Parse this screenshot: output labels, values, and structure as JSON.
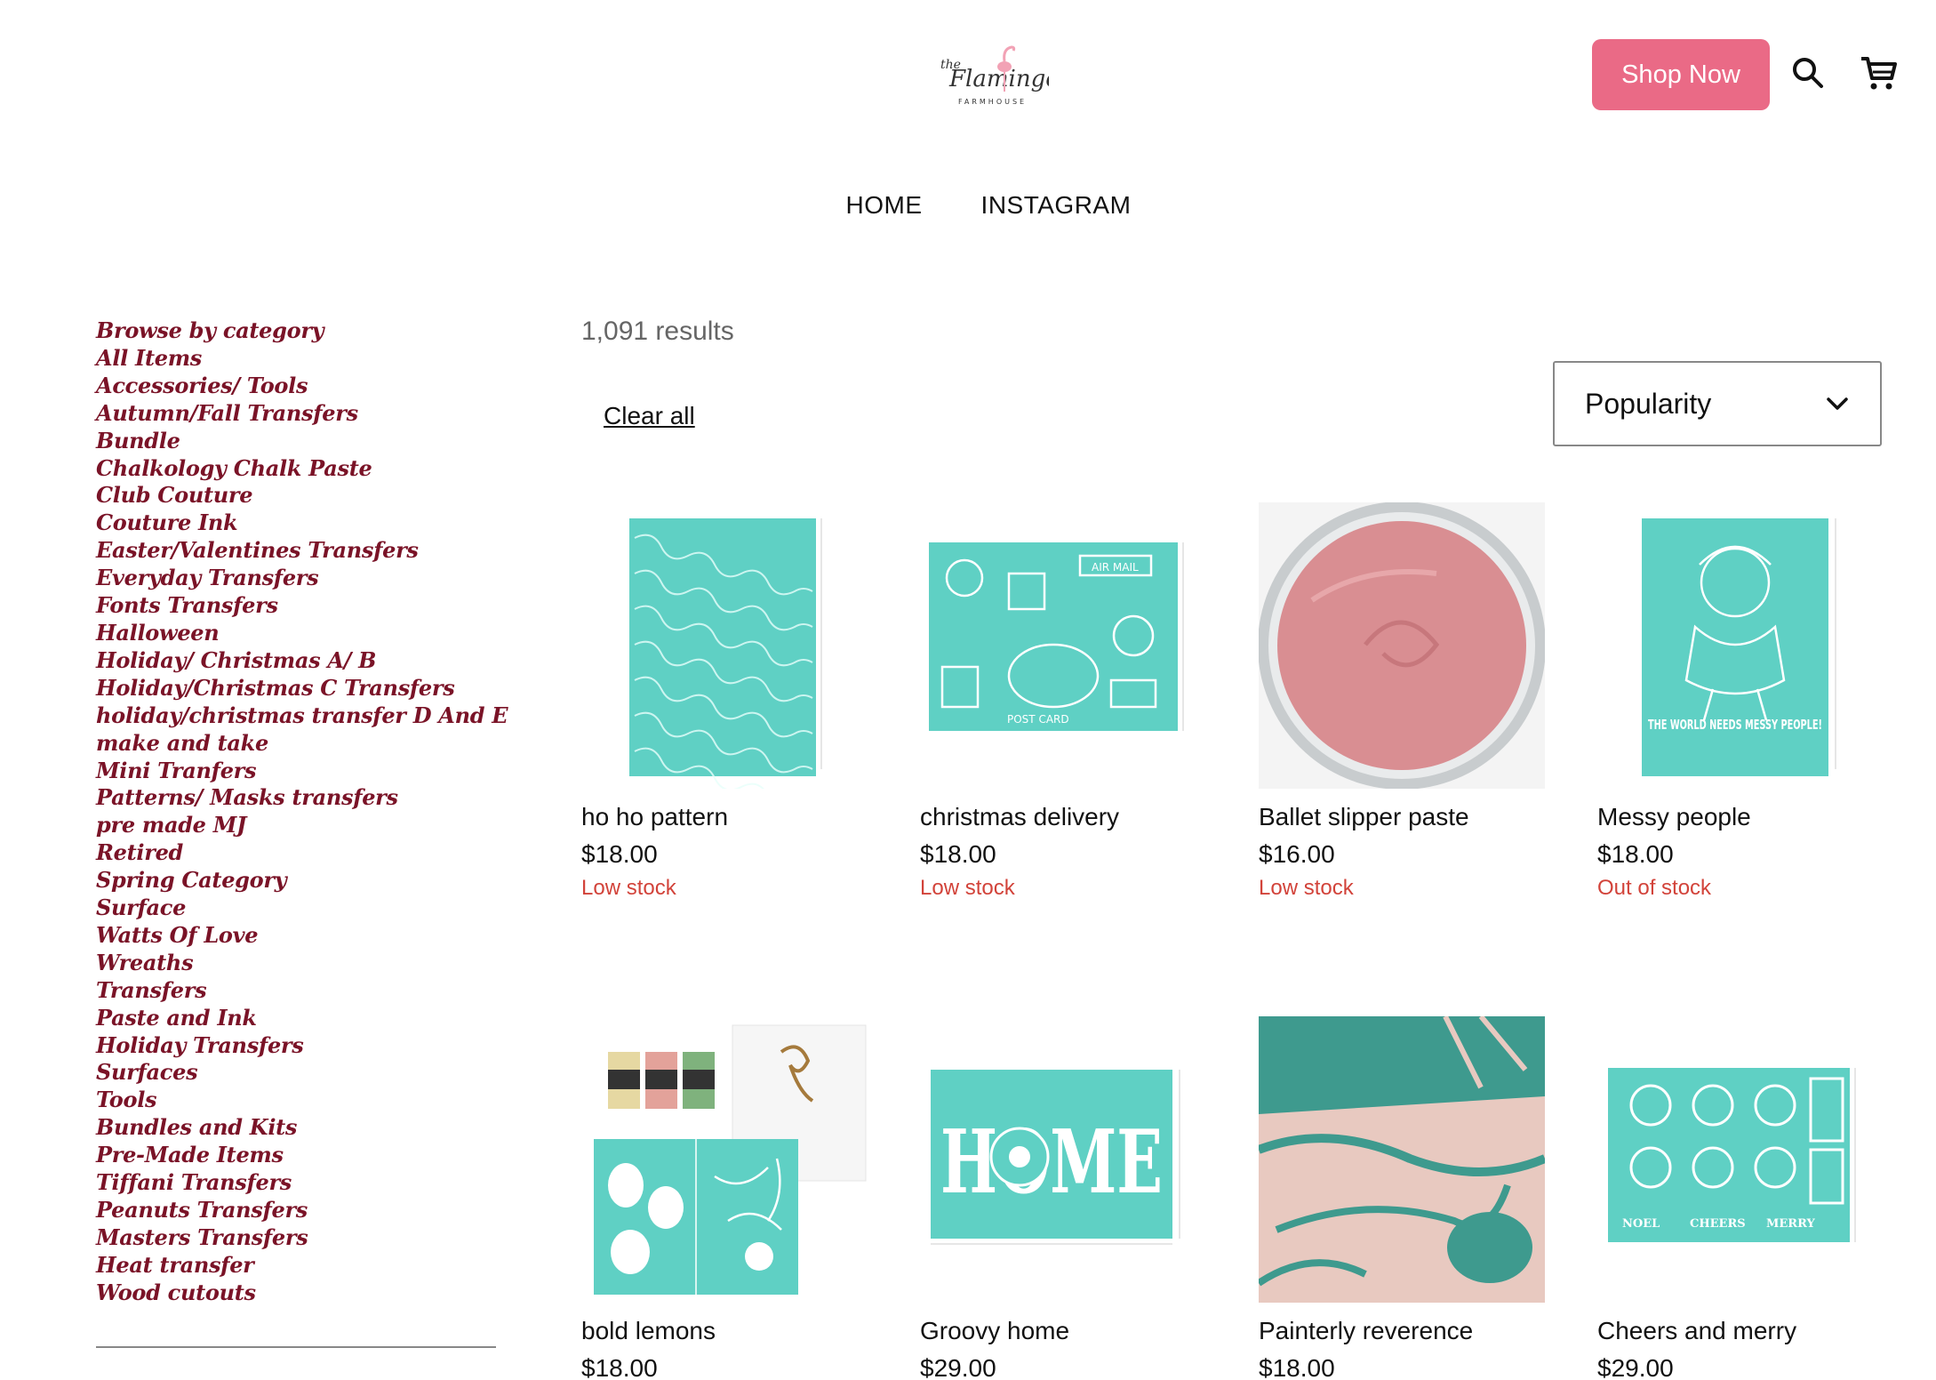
{
  "header": {
    "logo_text": "the Flamingo FARMHOUSE",
    "shop_label": "Shop Now",
    "search_icon": "search-icon",
    "cart_icon": "cart-icon",
    "accent": "#ea6a86"
  },
  "nav": {
    "items": [
      "HOME",
      "INSTAGRAM"
    ]
  },
  "sidebar": {
    "title": "Browse by category",
    "categories": [
      "All Items",
      "Accessories/ Tools",
      "Autumn/Fall Transfers",
      "Bundle",
      "Chalkology Chalk Paste",
      "Club Couture",
      "Couture Ink",
      "Easter/Valentines Transfers",
      "Everyday Transfers",
      "Fonts Transfers",
      "Halloween",
      "Holiday/ Christmas A/ B",
      "Holiday/Christmas C Transfers",
      "holiday/christmas transfer D And E",
      "make and take",
      "Mini Tranfers",
      "Patterns/ Masks transfers",
      "pre made MJ",
      "Retired",
      "Spring Category",
      "Surface",
      "Watts Of Love",
      "Wreaths",
      "Transfers",
      "Paste and Ink",
      "Holiday Transfers",
      "Surfaces",
      "Tools",
      "Bundles and Kits",
      "Pre-Made Items",
      "Tiffani Transfers",
      "Peanuts Transfers",
      "Masters Transfers",
      "Heat transfer",
      "Wood cutouts"
    ],
    "color": "#7a1327"
  },
  "main": {
    "results": "1,091 results",
    "clear_all": "Clear all",
    "sort_value": "Popularity"
  },
  "products": [
    {
      "name": "ho ho pattern",
      "price": "$18.00",
      "stock": "Low stock"
    },
    {
      "name": "christmas delivery",
      "price": "$18.00",
      "stock": "Low stock"
    },
    {
      "name": "Ballet slipper paste",
      "price": "$16.00",
      "stock": "Low stock"
    },
    {
      "name": "Messy people",
      "price": "$18.00",
      "stock": "Out of stock"
    },
    {
      "name": "bold lemons",
      "price": "$18.00",
      "stock": ""
    },
    {
      "name": "Groovy home",
      "price": "$29.00",
      "stock": ""
    },
    {
      "name": "Painterly reverence",
      "price": "$18.00",
      "stock": ""
    },
    {
      "name": "Cheers and merry",
      "price": "$29.00",
      "stock": ""
    }
  ],
  "image_text": {
    "messy": "THE WORLD NEEDS MESSY PEOPLE!",
    "home": "HOME",
    "cheers": [
      "NOEL",
      "CHEERS",
      "MERRY"
    ],
    "airmail": "AIR MAIL",
    "postcard": "POST CARD"
  },
  "colors": {
    "teal": "#5fd0c4",
    "paste_pink": "#d98e92",
    "stock_red": "#d2433a"
  }
}
